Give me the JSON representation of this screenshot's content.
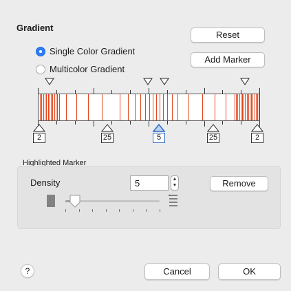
{
  "gradient": {
    "title": "Gradient",
    "reset_label": "Reset",
    "add_marker_label": "Add Marker",
    "options": [
      {
        "label": "Single Color Gradient",
        "selected": true
      },
      {
        "label": "Multicolor Gradient",
        "selected": false
      }
    ]
  },
  "gradient_bar": {
    "stripe_color": "#e2461d",
    "markers": [
      "2",
      "25",
      "5",
      "25",
      "2"
    ],
    "selected_marker_index": 2
  },
  "highlighted_marker": {
    "section_label": "Highlighted Marker",
    "density_label": "Density",
    "density_value": "5",
    "remove_label": "Remove",
    "slider_fraction": 0.1
  },
  "footer": {
    "help_label": "?",
    "cancel_label": "Cancel",
    "ok_label": "OK"
  },
  "colors": {
    "accent": "#2f7df6",
    "selected_marker": "#2f6bc4"
  }
}
